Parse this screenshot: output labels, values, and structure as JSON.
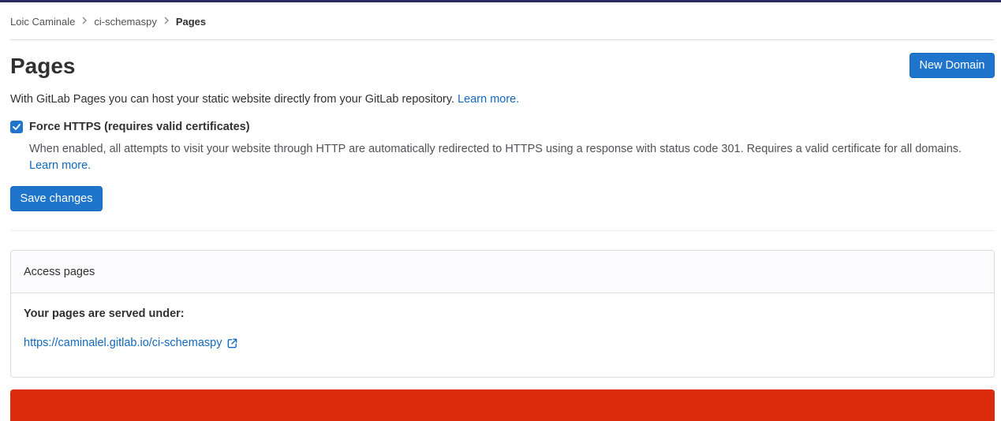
{
  "breadcrumb": {
    "items": [
      "Loic Caminale",
      "ci-schemaspy"
    ],
    "current": "Pages"
  },
  "page": {
    "title": "Pages",
    "new_domain_label": "New Domain",
    "intro_text": "With GitLab Pages you can host your static website directly from your GitLab repository.",
    "intro_link": "Learn more."
  },
  "force_https": {
    "checked": true,
    "label": "Force HTTPS (requires valid certificates)",
    "help_text": "When enabled, all attempts to visit your website through HTTP are automatically redirected to HTTPS using a response with status code 301. Requires a valid certificate for all domains.",
    "help_link": "Learn more."
  },
  "save_changes_label": "Save changes",
  "access_card": {
    "header": "Access pages",
    "served_under_label": "Your pages are served under:",
    "url": "https://caminalel.gitlab.io/ci-schemaspy",
    "url_icon": "external-link-icon"
  },
  "colors": {
    "accent": "#1f75cb",
    "link": "#1068bf",
    "danger": "#dd2b0e",
    "topbar": "#292961"
  }
}
